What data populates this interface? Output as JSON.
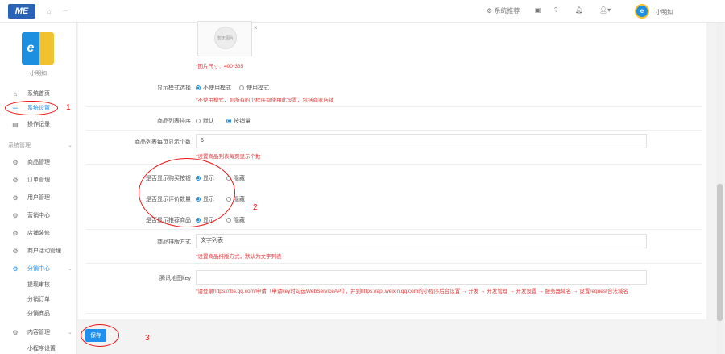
{
  "topbar": {
    "logo": "ME",
    "breadcrumb": "...",
    "items": [
      {
        "icon": "gear-icon",
        "label": "系统推荐"
      },
      {
        "icon": "box-icon"
      },
      {
        "icon": "help-icon"
      },
      {
        "icon": "bell-icon"
      },
      {
        "icon": "user-icon"
      }
    ],
    "user_name": "小明如"
  },
  "sidebar": {
    "store_name": "小明如",
    "items": [
      {
        "label": "系统首页",
        "icon": "home-icon"
      },
      {
        "label": "系统设置",
        "icon": "list-icon",
        "active": true
      },
      {
        "label": "操作记录",
        "icon": "doc-icon"
      }
    ],
    "section_title": "系统管理",
    "modules": [
      {
        "label": "商品管理"
      },
      {
        "label": "订单管理"
      },
      {
        "label": "用户管理"
      },
      {
        "label": "营销中心"
      },
      {
        "label": "店铺装修"
      },
      {
        "label": "商户活动管理"
      },
      {
        "label": "分销中心"
      }
    ],
    "sub_items": [
      {
        "label": "提现审核"
      },
      {
        "label": "分销订单"
      },
      {
        "label": "分销商品"
      }
    ],
    "module_bottom": {
      "label": "内容管理"
    },
    "bottom_item": {
      "label": "小程序设置"
    }
  },
  "form": {
    "image_hint": "*图片尺寸：400*335",
    "image_placeholder": "暂无图片",
    "row1": {
      "label": "显示模式选择",
      "opt_a": "不使用模式",
      "opt_b": "使用模式",
      "hint": "*不使用模式，则所有的小程序都使用此设置，包括商家店铺"
    },
    "row2": {
      "label": "商品列表排序",
      "opt_a": "默认",
      "opt_b": "按销量"
    },
    "row3": {
      "label": "商品列表每页显示个数",
      "value": "6",
      "hint": "*设置商品列表每页显示个数"
    },
    "row4": {
      "label": "是否显示购买按钮",
      "opt_a": "显示",
      "opt_b": "隐藏"
    },
    "row5": {
      "label": "是否显示评价数量",
      "opt_a": "显示",
      "opt_b": "隐藏"
    },
    "row6": {
      "label": "是否显示推荐商品",
      "opt_a": "显示",
      "opt_b": "隐藏"
    },
    "row7": {
      "label": "商品排版方式",
      "value": "文字列表",
      "hint": "*设置商品排版方式，默认为文字列表"
    },
    "row8": {
      "label": "腾讯地图key",
      "value": "",
      "hint": "*请登录https://lbs.qq.com/申请（申请key时勾选WebServiceAPI），并到https://api.weixin.qq.com的小程序后台设置 → 开发 → 开发管理 → 开发设置 → 服务器域名 → 设置request合法域名"
    }
  },
  "save_label": "保存",
  "annotations": [
    "1",
    "2",
    "3"
  ]
}
